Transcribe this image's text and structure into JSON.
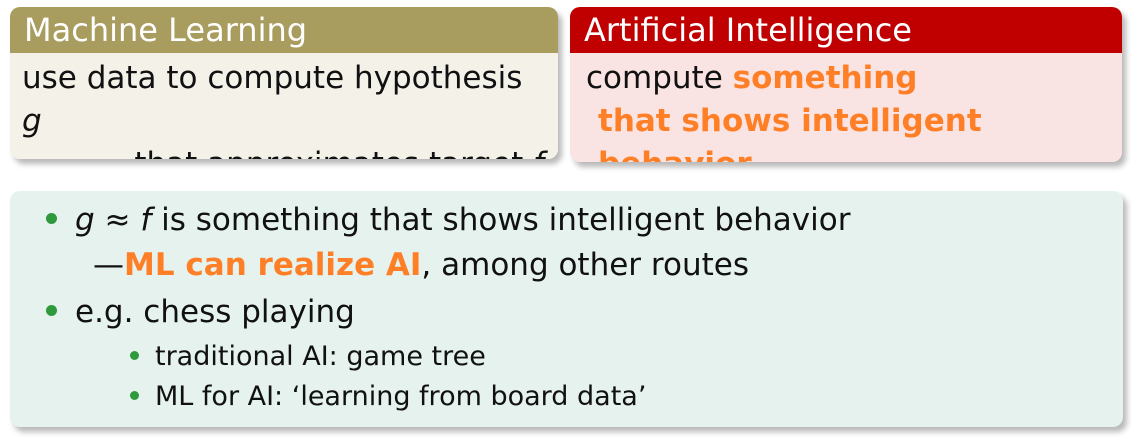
{
  "ml_block": {
    "title": "Machine Learning",
    "line1_text": "use data to compute hypothesis ",
    "line1_var": "g",
    "line2_text": "that approximates target ",
    "line2_var": "f"
  },
  "ai_block": {
    "title": "Artificial Intelligence",
    "line1_text": "compute ",
    "line1_accent": "something",
    "line2_accent": "that shows intelligent behavior"
  },
  "notes": {
    "bullet1_var_g": "g",
    "bullet1_approx": " ≈ ",
    "bullet1_var_f": "f",
    "bullet1_text": " is something that shows intelligent behavior",
    "bullet1_cont_dash": "—",
    "bullet1_cont_accent": "ML can realize AI",
    "bullet1_cont_text": ", among other routes",
    "bullet2_text": "e.g. chess playing",
    "sub_items": [
      "traditional AI: game tree",
      "ML for AI: ‘learning from board data’"
    ]
  },
  "colors": {
    "ml_header": "#a89c5e",
    "ml_body": "#f4f1e9",
    "ai_header": "#c00000",
    "ai_body": "#f9e3e3",
    "notes_bg": "#e5f2ee",
    "accent": "#ff7f27",
    "bullet": "#2e9a3c"
  }
}
